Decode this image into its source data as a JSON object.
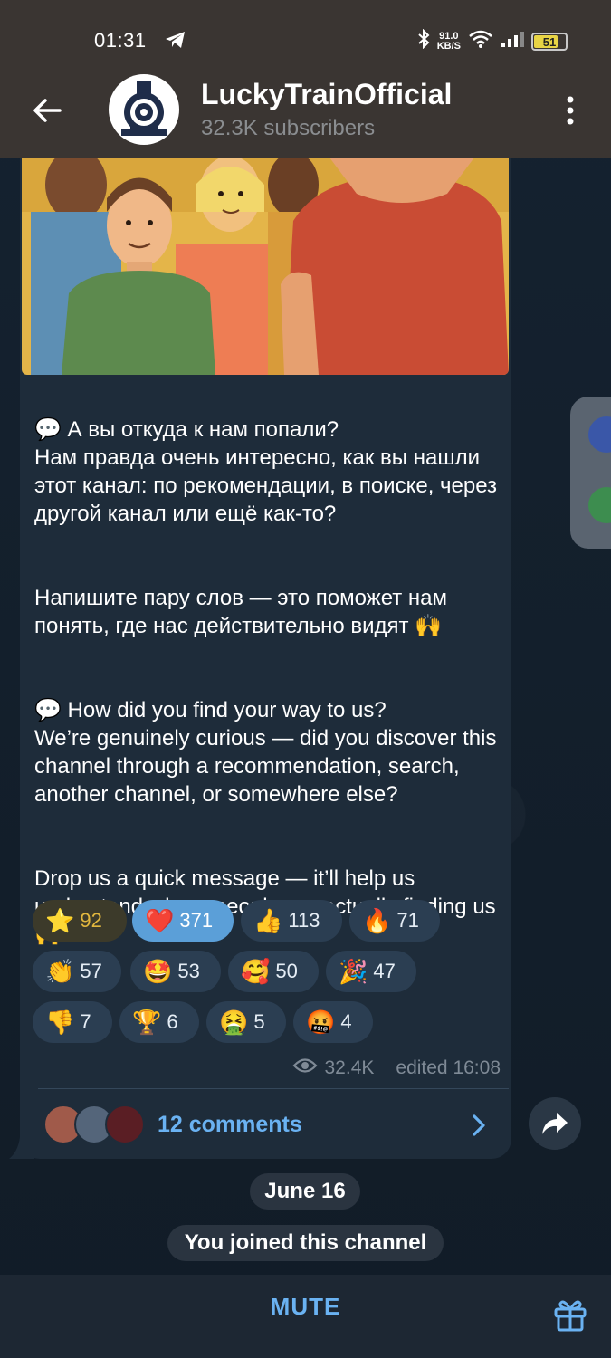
{
  "status_bar": {
    "time": "01:31",
    "speed_value": "91.0",
    "speed_unit": "KB/S",
    "battery": "51"
  },
  "header": {
    "channel_name": "LuckyTrainOfficial",
    "subscribers": "32.3K subscribers"
  },
  "message": {
    "paragraphs": [
      "💬 А вы откуда к нам попали?\nНам правда очень интересно, как вы нашли этот канал: по рекомендации, в поиске, через другой канал или ещё как-то?",
      "Напишите пару слов — это поможет нам понять, где нас действительно видят 🙌",
      "💬 How did you find your way to us?\nWe’re genuinely curious — did you discover this channel through a recommendation, search, another channel, or somewhere else?",
      "Drop us a quick message — it’ll help us understand where people are actually finding us 🙌"
    ],
    "reactions": [
      {
        "emoji": "⭐",
        "count": "92"
      },
      {
        "emoji": "❤️",
        "count": "371"
      },
      {
        "emoji": "👍",
        "count": "113"
      },
      {
        "emoji": "🔥",
        "count": "71"
      },
      {
        "emoji": "👏",
        "count": "57"
      },
      {
        "emoji": "🤩",
        "count": "53"
      },
      {
        "emoji": "🥰",
        "count": "50"
      },
      {
        "emoji": "🎉",
        "count": "47"
      },
      {
        "emoji": "👎",
        "count": "7"
      },
      {
        "emoji": "🏆",
        "count": "6"
      },
      {
        "emoji": "🤮",
        "count": "5"
      },
      {
        "emoji": "🤬",
        "count": "4"
      }
    ],
    "views": "32.4K",
    "edited": "edited 16:08",
    "comments": "12 comments"
  },
  "service": {
    "date": "June 16",
    "joined": "You joined this channel"
  },
  "bottom": {
    "mute_label": "MUTE"
  },
  "colors": {
    "accent": "#6ab2f2",
    "bubble": "#1e2c3a",
    "header": "#3a3532"
  }
}
